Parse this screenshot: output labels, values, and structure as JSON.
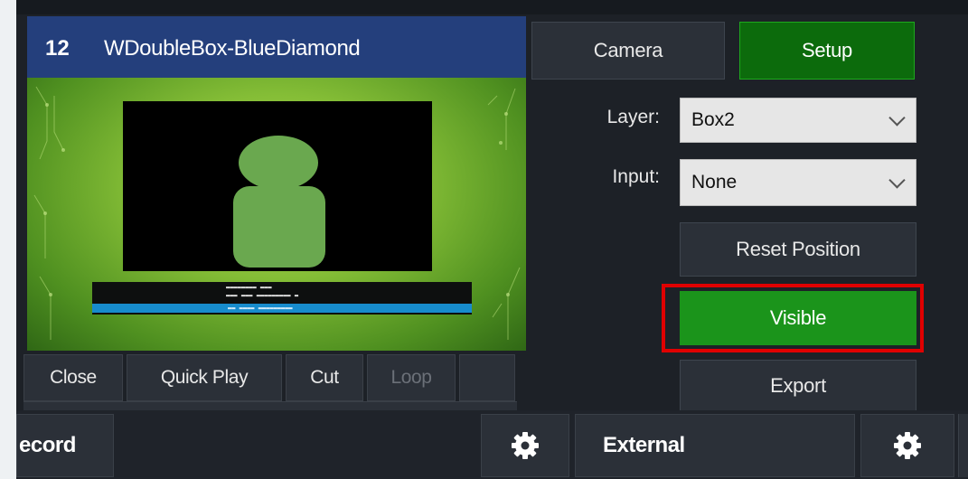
{
  "input": {
    "number": "12",
    "title": "WDoubleBox-BlueDiamond",
    "preview_ticker_lines": [
      "▬▬▬▬▬▬▬▬ ▬▬▬",
      "▬▬▬ ▬▬▬ ▬▬▬▬▬▬▬▬▬ ▬",
      "▬▬ ▬▬▬▬ ▬▬▬▬▬▬▬▬▬"
    ]
  },
  "panel": {
    "camera_tab": "Camera",
    "setup_tab": "Setup",
    "layer_label": "Layer:",
    "layer_value": "Box2",
    "input_label": "Input:",
    "input_value": "None",
    "reset_position": "Reset Position",
    "visible": "Visible",
    "export": "Export"
  },
  "controls": {
    "close": "Close",
    "quick_play": "Quick Play",
    "cut": "Cut",
    "loop": "Loop"
  },
  "bottom": {
    "record_partial": "ecord",
    "external": "External",
    "gear_icon": "gear-icon"
  },
  "colors": {
    "header_blue": "#243f7c",
    "setup_green": "#0c6b0c",
    "visible_green": "#1b941b",
    "highlight_red": "#e00000"
  }
}
